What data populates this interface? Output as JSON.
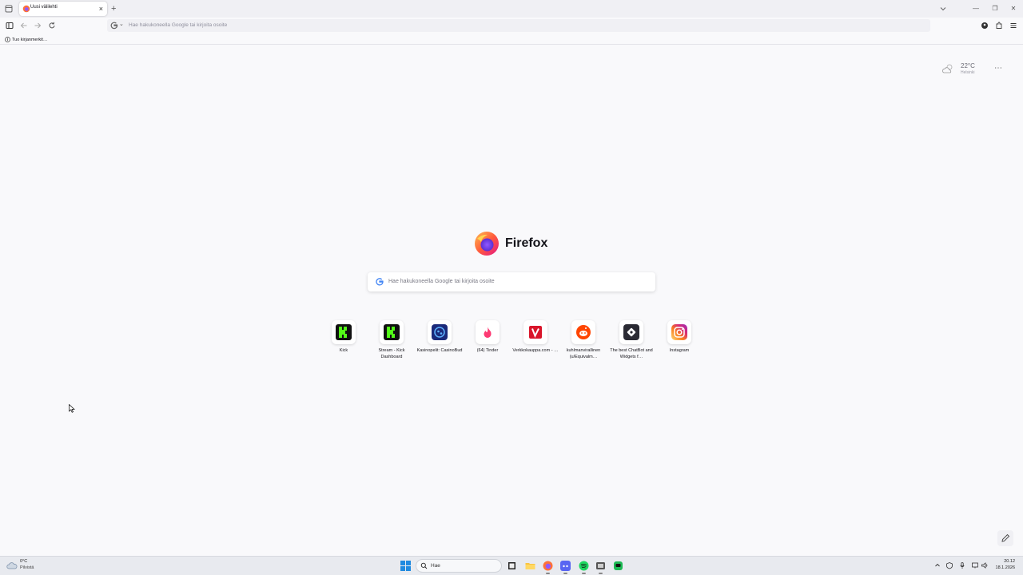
{
  "browser": {
    "tab": {
      "title": "Uusi välilehti",
      "close": "×"
    },
    "new_tab": "+",
    "window_controls": {
      "minimize": "—",
      "maximize": "❐",
      "close": "✕"
    },
    "urlbar": {
      "placeholder": "Hae hakukoneella Google tai kirjoita osoite",
      "engine_icon": "google-icon"
    },
    "bookmarks": {
      "import_label": "Tuo kirjanmerkit…"
    }
  },
  "newtab": {
    "weather": {
      "temperature": "22°C",
      "location": "Helsinki"
    },
    "brand": "Firefox",
    "search": {
      "placeholder": "Hae hakukoneella Google tai kirjoita osoite"
    },
    "shortcuts": [
      {
        "label": "Kick",
        "icon": "kick-icon"
      },
      {
        "label": "Stream - Kick Dashboard",
        "icon": "kick-dashboard-icon"
      },
      {
        "label": "Kasinopelit: CasinoBud",
        "icon": "casinobud-icon"
      },
      {
        "label": "(64) Tinder",
        "icon": "tinder-icon"
      },
      {
        "label": "Verkkokauppa.com - …",
        "icon": "verkkokauppa-icon"
      },
      {
        "label": "kuhlmanvirallinen (u/Equivalm…",
        "icon": "reddit-icon"
      },
      {
        "label": "The best ChatBot and Widgets f…",
        "icon": "chatbot-icon"
      },
      {
        "label": "Instagram",
        "icon": "instagram-icon"
      }
    ]
  },
  "taskbar": {
    "weather": {
      "temperature": "0°C",
      "condition": "Pilvistä"
    },
    "search_label": "Hae",
    "clock": {
      "time": "20.12",
      "date": "18.1.2026"
    }
  }
}
